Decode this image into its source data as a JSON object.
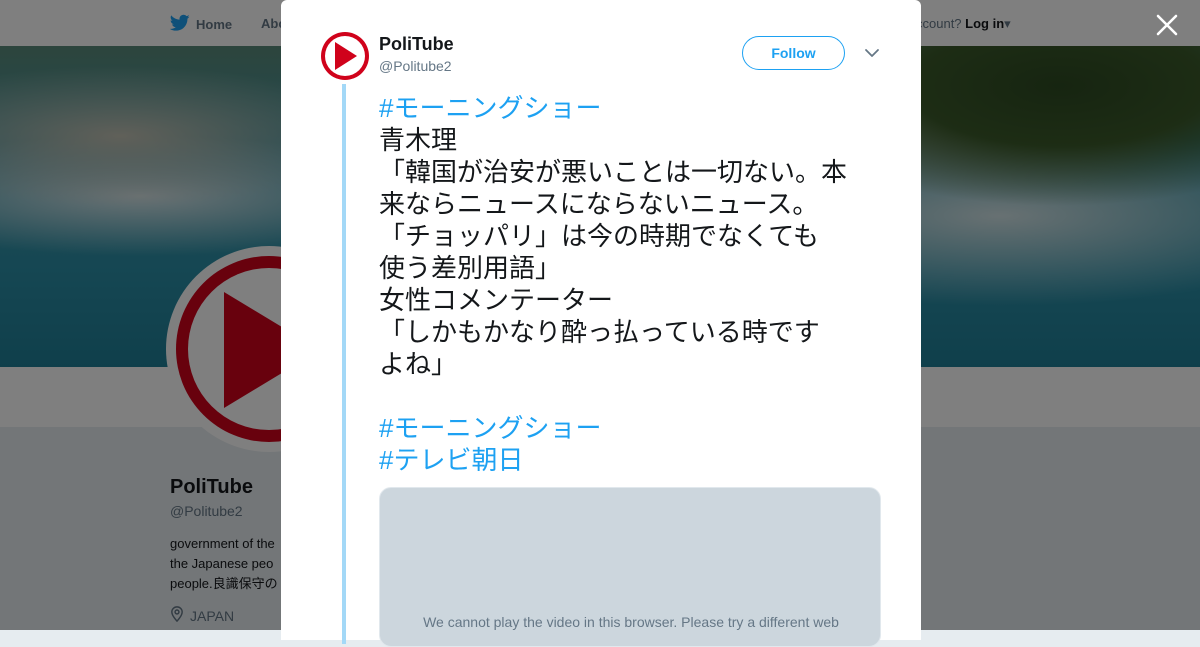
{
  "nav": {
    "home": "Home",
    "about": "Abo",
    "login_prefix": "ccount?",
    "login": "Log in"
  },
  "profile": {
    "name": "PoliTube",
    "handle": "@Politube2",
    "bio_lines": [
      "government of the",
      "the Japanese peo",
      "people.良識保守の"
    ],
    "location": "JAPAN"
  },
  "tweet": {
    "name": "PoliTube",
    "handle": "@Politube2",
    "follow_label": "Follow",
    "lines": [
      {
        "text": "#モーニングショー",
        "hashtag": true
      },
      {
        "text": "青木理",
        "hashtag": false
      },
      {
        "text": "「韓国が治安が悪いことは一切ない。本",
        "hashtag": false
      },
      {
        "text": "来ならニュースにならないニュース。",
        "hashtag": false
      },
      {
        "text": "「チョッパリ」は今の時期でなくても",
        "hashtag": false
      },
      {
        "text": "使う差別用語」",
        "hashtag": false
      },
      {
        "text": "女性コメンテーター",
        "hashtag": false
      },
      {
        "text": "「しかもかなり酔っ払っている時です",
        "hashtag": false
      },
      {
        "text": "よね」",
        "hashtag": false
      },
      {
        "text": "",
        "hashtag": false
      },
      {
        "text": "#モーニングショー",
        "hashtag": true
      },
      {
        "text": "#テレビ朝日",
        "hashtag": true
      }
    ],
    "video_message": "We cannot play the video in this browser. Please try a different web"
  },
  "colors": {
    "accent": "#1da1f2",
    "brand_red": "#d0021b",
    "thread_line": "#a3d8f7"
  },
  "icons": {
    "close": "close-icon",
    "caret": "chevron-down-icon",
    "home": "twitter-bird-icon",
    "location": "location-pin-icon"
  }
}
